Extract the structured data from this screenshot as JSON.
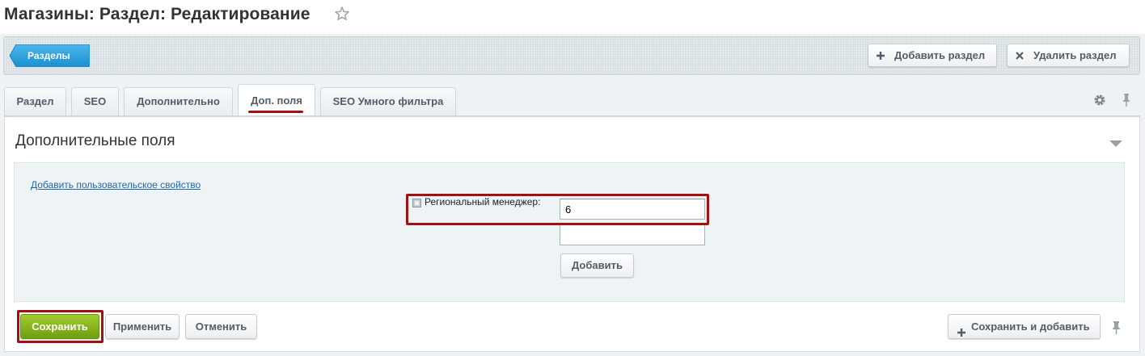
{
  "header": {
    "title": "Магазины: Раздел: Редактирование",
    "favorite_icon": "star-icon"
  },
  "toolbar": {
    "back_label": "Разделы",
    "add_section_label": "Добавить раздел",
    "delete_section_label": "Удалить раздел",
    "back_color": "#2fa4e0"
  },
  "tabs": [
    {
      "label": "Раздел",
      "active": false
    },
    {
      "label": "SEO",
      "active": false
    },
    {
      "label": "Дополнительно",
      "active": false
    },
    {
      "label": "Доп. поля",
      "active": true
    },
    {
      "label": "SEO Умного фильтра",
      "active": false
    }
  ],
  "tab_tools": {
    "settings_icon": "gear-icon",
    "pin_icon": "pin-icon"
  },
  "section": {
    "title": "Дополнительные поля",
    "add_property_link": "Добавить пользовательское свойство",
    "field_label": "Региональный менеджер:",
    "field_values": [
      "6",
      ""
    ],
    "add_button": "Добавить"
  },
  "footer": {
    "save_label": "Сохранить",
    "apply_label": "Применить",
    "cancel_label": "Отменить",
    "save_add_label": "Сохранить и добавить"
  },
  "colors": {
    "accent_red": "#a40f12",
    "save_green": "#8ab81f",
    "link_blue": "#2067b0"
  }
}
